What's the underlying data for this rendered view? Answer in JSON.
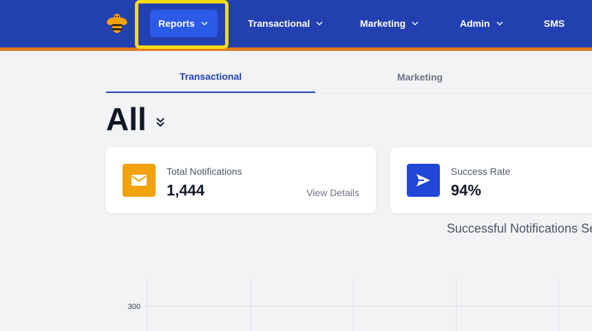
{
  "header": {
    "logo_icon": "bee-logo-icon",
    "nav": [
      {
        "label": "Reports",
        "has_dropdown": true,
        "active": true
      },
      {
        "label": "Transactional",
        "has_dropdown": true
      },
      {
        "label": "Marketing",
        "has_dropdown": true
      },
      {
        "label": "Admin",
        "has_dropdown": true
      },
      {
        "label": "SMS",
        "has_dropdown": false
      }
    ],
    "colors": {
      "bar": "#2340b0",
      "accent_border": "#e07b1c",
      "active_item": "#2b5be6",
      "highlight": "#f5dc14"
    }
  },
  "tabs": [
    {
      "label": "Transactional",
      "active": true
    },
    {
      "label": "Marketing",
      "active": false
    }
  ],
  "filter": {
    "title": "All",
    "icon": "double-chevron-down-icon"
  },
  "cards": [
    {
      "label": "Total Notifications",
      "value": "1,444",
      "link": "View Details",
      "icon": "envelope-icon",
      "icon_color": "#f2a10f"
    },
    {
      "label": "Success Rate",
      "value": "94%",
      "icon": "send-arrow-icon",
      "icon_color": "#2147d6"
    }
  ],
  "chart_data": {
    "type": "line",
    "title": "Successful Notifications Se",
    "ytick_labels": [
      "300"
    ],
    "grid": true
  }
}
